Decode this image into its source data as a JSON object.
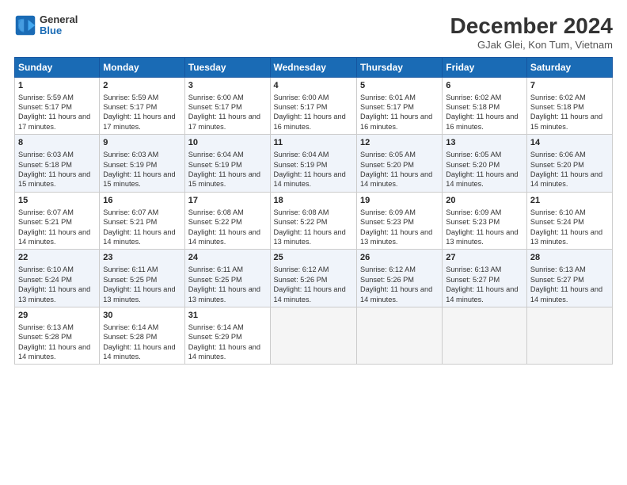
{
  "header": {
    "logo_line1": "General",
    "logo_line2": "Blue",
    "month": "December 2024",
    "location": "GJak Glei, Kon Tum, Vietnam"
  },
  "days_of_week": [
    "Sunday",
    "Monday",
    "Tuesday",
    "Wednesday",
    "Thursday",
    "Friday",
    "Saturday"
  ],
  "weeks": [
    [
      {
        "day": 1,
        "sunrise": "5:59 AM",
        "sunset": "5:17 PM",
        "daylight": "11 hours and 17 minutes."
      },
      {
        "day": 2,
        "sunrise": "5:59 AM",
        "sunset": "5:17 PM",
        "daylight": "11 hours and 17 minutes."
      },
      {
        "day": 3,
        "sunrise": "6:00 AM",
        "sunset": "5:17 PM",
        "daylight": "11 hours and 17 minutes."
      },
      {
        "day": 4,
        "sunrise": "6:00 AM",
        "sunset": "5:17 PM",
        "daylight": "11 hours and 16 minutes."
      },
      {
        "day": 5,
        "sunrise": "6:01 AM",
        "sunset": "5:17 PM",
        "daylight": "11 hours and 16 minutes."
      },
      {
        "day": 6,
        "sunrise": "6:02 AM",
        "sunset": "5:18 PM",
        "daylight": "11 hours and 16 minutes."
      },
      {
        "day": 7,
        "sunrise": "6:02 AM",
        "sunset": "5:18 PM",
        "daylight": "11 hours and 15 minutes."
      }
    ],
    [
      {
        "day": 8,
        "sunrise": "6:03 AM",
        "sunset": "5:18 PM",
        "daylight": "11 hours and 15 minutes."
      },
      {
        "day": 9,
        "sunrise": "6:03 AM",
        "sunset": "5:19 PM",
        "daylight": "11 hours and 15 minutes."
      },
      {
        "day": 10,
        "sunrise": "6:04 AM",
        "sunset": "5:19 PM",
        "daylight": "11 hours and 15 minutes."
      },
      {
        "day": 11,
        "sunrise": "6:04 AM",
        "sunset": "5:19 PM",
        "daylight": "11 hours and 14 minutes."
      },
      {
        "day": 12,
        "sunrise": "6:05 AM",
        "sunset": "5:20 PM",
        "daylight": "11 hours and 14 minutes."
      },
      {
        "day": 13,
        "sunrise": "6:05 AM",
        "sunset": "5:20 PM",
        "daylight": "11 hours and 14 minutes."
      },
      {
        "day": 14,
        "sunrise": "6:06 AM",
        "sunset": "5:20 PM",
        "daylight": "11 hours and 14 minutes."
      }
    ],
    [
      {
        "day": 15,
        "sunrise": "6:07 AM",
        "sunset": "5:21 PM",
        "daylight": "11 hours and 14 minutes."
      },
      {
        "day": 16,
        "sunrise": "6:07 AM",
        "sunset": "5:21 PM",
        "daylight": "11 hours and 14 minutes."
      },
      {
        "day": 17,
        "sunrise": "6:08 AM",
        "sunset": "5:22 PM",
        "daylight": "11 hours and 14 minutes."
      },
      {
        "day": 18,
        "sunrise": "6:08 AM",
        "sunset": "5:22 PM",
        "daylight": "11 hours and 13 minutes."
      },
      {
        "day": 19,
        "sunrise": "6:09 AM",
        "sunset": "5:23 PM",
        "daylight": "11 hours and 13 minutes."
      },
      {
        "day": 20,
        "sunrise": "6:09 AM",
        "sunset": "5:23 PM",
        "daylight": "11 hours and 13 minutes."
      },
      {
        "day": 21,
        "sunrise": "6:10 AM",
        "sunset": "5:24 PM",
        "daylight": "11 hours and 13 minutes."
      }
    ],
    [
      {
        "day": 22,
        "sunrise": "6:10 AM",
        "sunset": "5:24 PM",
        "daylight": "11 hours and 13 minutes."
      },
      {
        "day": 23,
        "sunrise": "6:11 AM",
        "sunset": "5:25 PM",
        "daylight": "11 hours and 13 minutes."
      },
      {
        "day": 24,
        "sunrise": "6:11 AM",
        "sunset": "5:25 PM",
        "daylight": "11 hours and 13 minutes."
      },
      {
        "day": 25,
        "sunrise": "6:12 AM",
        "sunset": "5:26 PM",
        "daylight": "11 hours and 14 minutes."
      },
      {
        "day": 26,
        "sunrise": "6:12 AM",
        "sunset": "5:26 PM",
        "daylight": "11 hours and 14 minutes."
      },
      {
        "day": 27,
        "sunrise": "6:13 AM",
        "sunset": "5:27 PM",
        "daylight": "11 hours and 14 minutes."
      },
      {
        "day": 28,
        "sunrise": "6:13 AM",
        "sunset": "5:27 PM",
        "daylight": "11 hours and 14 minutes."
      }
    ],
    [
      {
        "day": 29,
        "sunrise": "6:13 AM",
        "sunset": "5:28 PM",
        "daylight": "11 hours and 14 minutes."
      },
      {
        "day": 30,
        "sunrise": "6:14 AM",
        "sunset": "5:28 PM",
        "daylight": "11 hours and 14 minutes."
      },
      {
        "day": 31,
        "sunrise": "6:14 AM",
        "sunset": "5:29 PM",
        "daylight": "11 hours and 14 minutes."
      },
      null,
      null,
      null,
      null
    ]
  ]
}
